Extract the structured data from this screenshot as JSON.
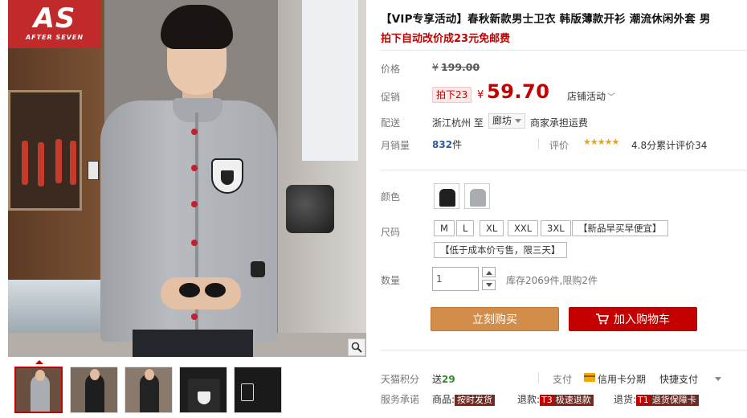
{
  "brand": {
    "logo_text": "AS",
    "logo_subtext": "AFTER SEVEN"
  },
  "gallery": {
    "zoom_icon": "magnifier-icon",
    "thumbnails": [
      "thumb-1",
      "thumb-2",
      "thumb-3",
      "thumb-4",
      "thumb-5"
    ],
    "active_thumbnail": 0
  },
  "product": {
    "title": "【VIP专享活动】春秋新款男士卫衣 韩版薄款开衫 潮流休闲外套 男",
    "subtitle": "拍下自动改价成23元免邮费"
  },
  "price": {
    "label": "价格",
    "currency": "¥",
    "original": "199.00"
  },
  "promo": {
    "label": "促销",
    "tag": "拍下23",
    "currency": "¥",
    "price": "59.70",
    "shop_activity": "店铺活动",
    "chevron_icon": "chevron-down-icon"
  },
  "shipping": {
    "label": "配送",
    "from": "浙江杭州",
    "to_word": "至",
    "destination": "廊坊",
    "note": "商家承担运费"
  },
  "sales": {
    "label": "月销量",
    "count": "832",
    "unit": "件",
    "rating_label": "评价",
    "stars": "★★★★★",
    "rating_text": "4.8分累计评价34"
  },
  "color": {
    "label": "颜色",
    "options": [
      {
        "name": "black",
        "hex": "#1f1f1f"
      },
      {
        "name": "gray",
        "hex": "#a9adb1"
      }
    ]
  },
  "size": {
    "label": "尺码",
    "options": [
      "M",
      "L",
      "XL",
      "XXL",
      "3XL",
      "【新品早买早便宜】",
      "【低于成本价亏售，限三天】"
    ]
  },
  "quantity": {
    "label": "数量",
    "value": "1",
    "stock": "库存2069件,限购2件",
    "increase_icon": "chevron-up-icon",
    "decrease_icon": "chevron-down-icon"
  },
  "actions": {
    "buy_now": "立刻购买",
    "add_to_cart": "加入购物车",
    "cart_icon": "shopping-cart-icon",
    "buy_color": "#d38d4b",
    "cart_color": "#c40000"
  },
  "points": {
    "label": "天猫积分",
    "prefix": "送",
    "value": "29"
  },
  "payment": {
    "label": "支付",
    "installment": "信用卡分期",
    "quick": "快捷支付",
    "card_icon": "credit-card-icon"
  },
  "service": {
    "label": "服务承诺",
    "items": [
      {
        "prefix": "商品:",
        "tag_key": "",
        "tag": "按时发货"
      },
      {
        "prefix": "退款:",
        "tag_key": "T3",
        "tag": "极速退款"
      },
      {
        "prefix": "退货:",
        "tag_key": "T1",
        "tag": "退货保障卡"
      }
    ]
  }
}
